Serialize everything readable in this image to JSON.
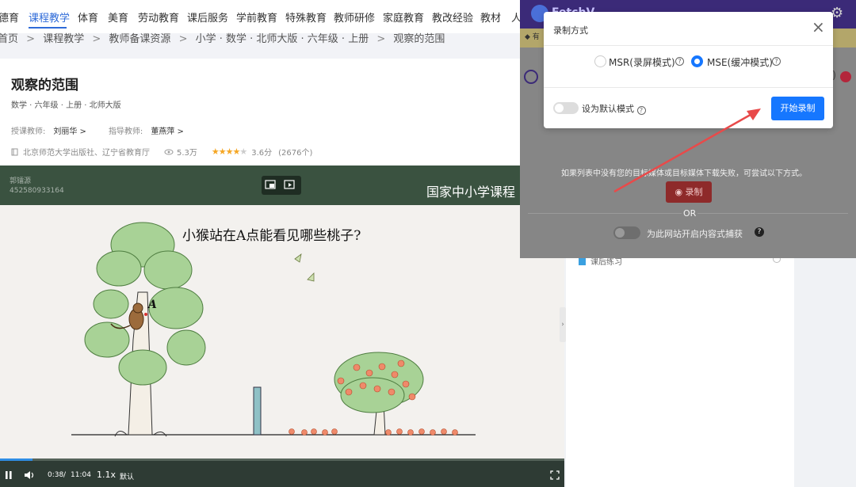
{
  "nav": {
    "items": [
      "德育",
      "课程教学",
      "体育",
      "美育",
      "劳动教育",
      "课后服务",
      "学前教育",
      "特殊教育",
      "教师研修",
      "家庭教育",
      "教改经验",
      "教材",
      "人"
    ],
    "active_index": 1
  },
  "breadcrumb": [
    "首页",
    "课程教学",
    "教师备课资源",
    "小学 · 数学 · 北师大版 · 六年级 · 上册",
    "观察的范围"
  ],
  "breadcrumb_sep": ">",
  "course": {
    "title": "观察的范围",
    "subtitle": "数学 · 六年级 · 上册 · 北师大版",
    "teacher_label": "授课教师:",
    "teacher_name": "刘丽华 >",
    "guide_label": "指导教师:",
    "guide_name": "董燕萍 >",
    "publisher": "北京师范大学出版社、辽宁省教育厅",
    "views": "5.3万",
    "rating": "3.6分",
    "rating_value": 3.6,
    "rating_count": "(2676个)"
  },
  "video": {
    "watermark_name": "郭镭源",
    "watermark_id": "452580933164",
    "banner_title": "国家中小学课程",
    "question": "小猴站在A点能看见哪些桃子?",
    "point_label": "A",
    "time_current": "0:38",
    "time_sep": "/",
    "time_total": "11:04",
    "speed": "1.1x",
    "quality": "默认",
    "progress_fraction": 0.057
  },
  "sidebar": {
    "lesson_label": "课后练习"
  },
  "extension": {
    "brand": "FetchV",
    "notice": "有",
    "hint": "如果列表中没有您的目标媒体或目标媒体下载失败，可尝试以下方式。",
    "record_button": "录制",
    "or": "OR",
    "sniff_label": "为此网站开启内容式捕获",
    "help": "?"
  },
  "modal": {
    "title": "录制方式",
    "close": "×",
    "option1": "MSR(录屏模式)",
    "option2": "MSE(缓冲模式)",
    "selected": 2,
    "qmark": "?",
    "default_label": "设为默认模式",
    "start_button": "开始录制"
  },
  "colors": {
    "accent": "#1677ff",
    "nav_active": "#2f6bd8",
    "arrow": "#e84a4a",
    "video_banner": "#3a5240",
    "ext_header": "#3b2a78"
  }
}
